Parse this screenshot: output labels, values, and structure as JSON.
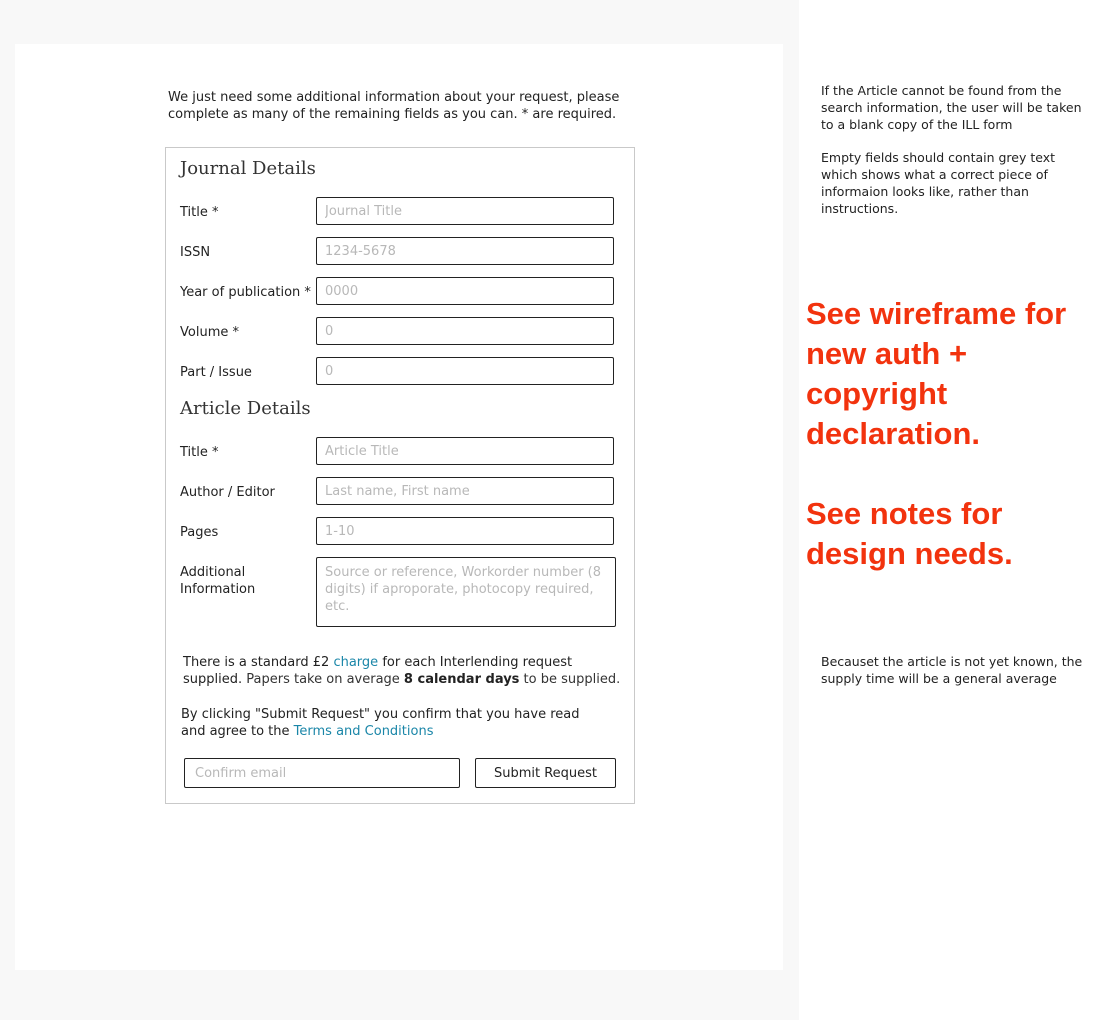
{
  "intro": "We just need some additional information about your request, please complete as many of the remaining fields as you can. * are required.",
  "journal": {
    "heading": "Journal Details",
    "fields": [
      {
        "label": "Title *",
        "placeholder": "Journal Title"
      },
      {
        "label": "ISSN",
        "placeholder": "1234-5678"
      },
      {
        "label": "Year of publication *",
        "placeholder": "0000"
      },
      {
        "label": "Volume *",
        "placeholder": "0"
      },
      {
        "label": "Part / Issue",
        "placeholder": "0"
      }
    ]
  },
  "article": {
    "heading": "Article Details",
    "fields": [
      {
        "label": "Title *",
        "placeholder": "Article Title"
      },
      {
        "label": "Author / Editor",
        "placeholder": "Last name, First name"
      },
      {
        "label": "Pages",
        "placeholder": "1-10"
      },
      {
        "label": "Additional Information",
        "placeholder": "Source or reference, Workorder number (8 digits) if aproporate, photocopy required, etc."
      }
    ]
  },
  "charge": {
    "before": "There is a standard £2 ",
    "link": "charge",
    "middle": " for each Interlending request supplied.",
    "papers": " Papers take on average ",
    "days": "8 calendar days",
    "after": " to be supplied."
  },
  "terms": {
    "before": "By clicking \"Submit Request\" you confirm that you have read and agree to the ",
    "link": "Terms and Conditions"
  },
  "email": {
    "placeholder": "Confirm email"
  },
  "submit_label": "Submit Request",
  "notes": {
    "not_found": "If the Article cannot be found from the search information, the user will be taken to a blank copy of the ILL form",
    "empty_fields": "Empty fields should contain grey text which shows what a correct piece of informaion looks like, rather than instructions.",
    "wireframe": "See wireframe for new auth + copyright declaration.",
    "design": "See notes for design needs.",
    "supply_time": "Becauset the article is not yet known, the supply time will be a general average"
  },
  "colors": {
    "link": "#1a86a8",
    "red_note": "#f2330e",
    "placeholder": "#b8b8b8"
  }
}
